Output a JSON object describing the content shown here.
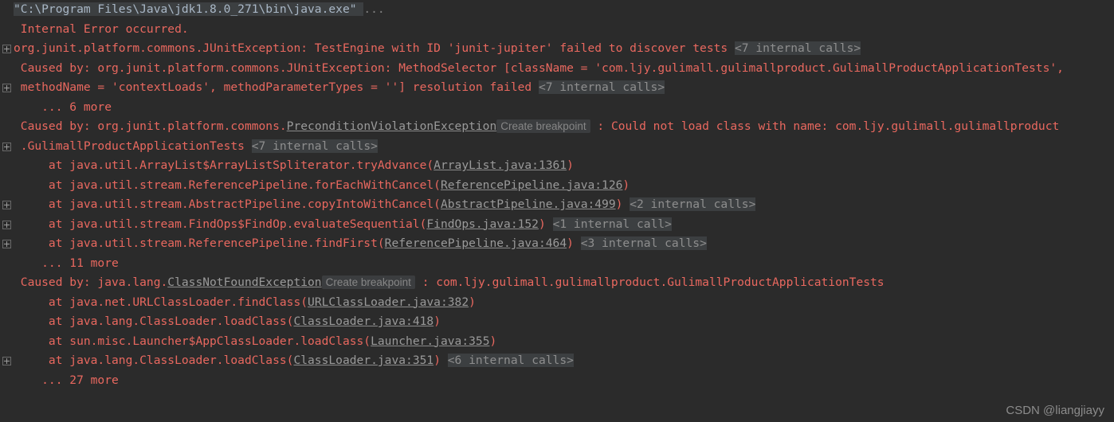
{
  "console": {
    "background_color": "#2b2b2b",
    "error_color": "#e9685f",
    "link_color": "#9a9a9a",
    "badge_background": "#3c3f41",
    "badge_text_color": "#8e8e8e",
    "command_text_color": "#a9b7c6",
    "watermark": "CSDN @liangjiayy",
    "inlay_hint_label": "Create breakpoint",
    "lines": [
      {
        "index": 0,
        "kind": "command",
        "fold": false,
        "text": "\"C:\\Program Files\\Java\\jdk1.8.0_271\\bin\\java.exe\" ...",
        "highlighted_part": "\"C:\\Program Files\\Java\\jdk1.8.0_271\\bin\\java.exe\" ",
        "ellipsis": "..."
      },
      {
        "index": 1,
        "kind": "error",
        "fold": false,
        "text": " Internal Error occurred."
      },
      {
        "index": 2,
        "kind": "error",
        "fold": true,
        "pre": "org.junit.platform.commons.JUnitException: TestEngine with ID 'junit-jupiter' failed to discover tests ",
        "badge": "<7 internal calls>"
      },
      {
        "index": 3,
        "kind": "error",
        "fold": false,
        "text": " Caused by: org.junit.platform.commons.JUnitException: MethodSelector [className = 'com.ljy.gulimall.gulimallproduct.GulimallProductApplicationTests',"
      },
      {
        "index": 4,
        "kind": "error",
        "fold": true,
        "pre": " methodName = 'contextLoads', methodParameterTypes = ''] resolution failed ",
        "badge": "<7 internal calls>"
      },
      {
        "index": 5,
        "kind": "error",
        "fold": false,
        "text": "    ... 6 more"
      },
      {
        "index": 6,
        "kind": "error-link-bp",
        "fold": false,
        "pre": " Caused by: org.junit.platform.commons.",
        "link": "PreconditionViolationException",
        "hint": "Create breakpoint",
        "post": " : Could not load class with name: com.ljy.gulimall.gulimallproduct"
      },
      {
        "index": 7,
        "kind": "error",
        "fold": true,
        "pre": " .GulimallProductApplicationTests ",
        "badge": "<7 internal calls>"
      },
      {
        "index": 8,
        "kind": "stack",
        "fold": false,
        "pre": "     at java.util.ArrayList$ArrayListSpliterator.tryAdvance(",
        "link": "ArrayList.java:1361",
        "post": ")"
      },
      {
        "index": 9,
        "kind": "stack",
        "fold": false,
        "pre": "     at java.util.stream.ReferencePipeline.forEachWithCancel(",
        "link": "ReferencePipeline.java:126",
        "post": ")"
      },
      {
        "index": 10,
        "kind": "stack",
        "fold": true,
        "pre": "     at java.util.stream.AbstractPipeline.copyIntoWithCancel(",
        "link": "AbstractPipeline.java:499",
        "post": ") ",
        "badge": "<2 internal calls>"
      },
      {
        "index": 11,
        "kind": "stack",
        "fold": true,
        "pre": "     at java.util.stream.FindOps$FindOp.evaluateSequential(",
        "link": "FindOps.java:152",
        "post": ") ",
        "badge": "<1 internal call>"
      },
      {
        "index": 12,
        "kind": "stack",
        "fold": true,
        "pre": "     at java.util.stream.ReferencePipeline.findFirst(",
        "link": "ReferencePipeline.java:464",
        "post": ") ",
        "badge": "<3 internal calls>"
      },
      {
        "index": 13,
        "kind": "error",
        "fold": false,
        "text": "    ... 11 more"
      },
      {
        "index": 14,
        "kind": "error-link-bp",
        "fold": false,
        "pre": " Caused by: java.lang.",
        "link": "ClassNotFoundException",
        "hint": "Create breakpoint",
        "post": " : com.ljy.gulimall.gulimallproduct.GulimallProductApplicationTests"
      },
      {
        "index": 15,
        "kind": "stack",
        "fold": false,
        "pre": "     at java.net.URLClassLoader.findClass(",
        "link": "URLClassLoader.java:382",
        "post": ")"
      },
      {
        "index": 16,
        "kind": "stack",
        "fold": false,
        "pre": "     at java.lang.ClassLoader.loadClass(",
        "link": "ClassLoader.java:418",
        "post": ")"
      },
      {
        "index": 17,
        "kind": "stack",
        "fold": false,
        "pre": "     at sun.misc.Launcher$AppClassLoader.loadClass(",
        "link": "Launcher.java:355",
        "post": ")"
      },
      {
        "index": 18,
        "kind": "stack",
        "fold": true,
        "pre": "     at java.lang.ClassLoader.loadClass(",
        "link": "ClassLoader.java:351",
        "post": ") ",
        "badge": "<6 internal calls>"
      },
      {
        "index": 19,
        "kind": "error",
        "fold": false,
        "text": "    ... 27 more"
      }
    ]
  }
}
